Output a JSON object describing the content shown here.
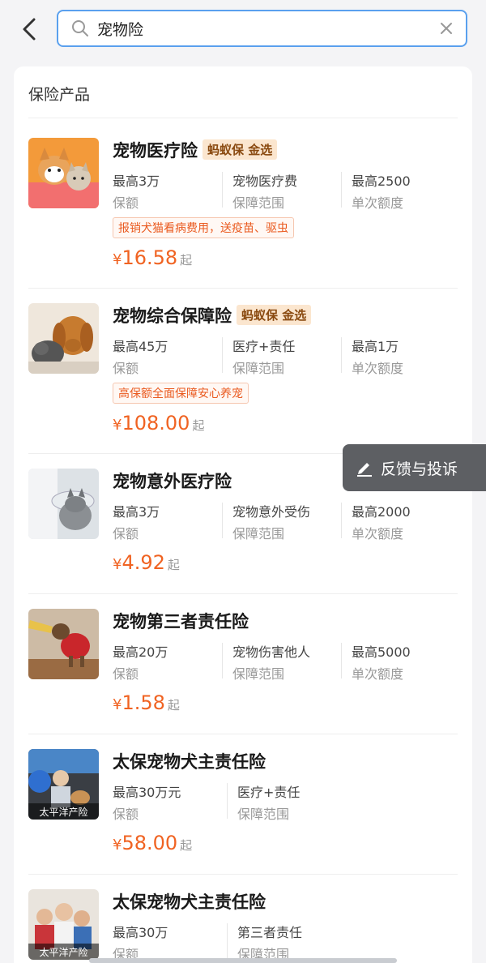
{
  "search": {
    "query": "宠物险"
  },
  "section": {
    "title": "保险产品"
  },
  "products": [
    {
      "name": "宠物医疗险",
      "badge": "蚂蚁保 金选",
      "stats": [
        {
          "value": "最高3万",
          "label": "保额"
        },
        {
          "value": "宠物医疗费",
          "label": "保障范围"
        },
        {
          "value": "最高2500",
          "label": "单次额度"
        }
      ],
      "tag": "报销犬猫看病费用，送疫苗、驱虫",
      "price": {
        "currency": "¥",
        "amount": "16.58",
        "suffix": "起"
      }
    },
    {
      "name": "宠物综合保障险",
      "badge": "蚂蚁保 金选",
      "stats": [
        {
          "value": "最高45万",
          "label": "保额"
        },
        {
          "value": "医疗+责任",
          "label": "保障范围"
        },
        {
          "value": "最高1万",
          "label": "单次额度"
        }
      ],
      "tag": "高保额全面保障安心养宠",
      "price": {
        "currency": "¥",
        "amount": "108.00",
        "suffix": "起"
      }
    },
    {
      "name": "宠物意外医疗险",
      "stats": [
        {
          "value": "最高3万",
          "label": "保额"
        },
        {
          "value": "宠物意外受伤",
          "label": "保障范围"
        },
        {
          "value": "最高2000",
          "label": "单次额度"
        }
      ],
      "price": {
        "currency": "¥",
        "amount": "4.92",
        "suffix": "起"
      }
    },
    {
      "name": "宠物第三者责任险",
      "stats": [
        {
          "value": "最高20万",
          "label": "保额"
        },
        {
          "value": "宠物伤害他人",
          "label": "保障范围"
        },
        {
          "value": "最高5000",
          "label": "单次额度"
        }
      ],
      "price": {
        "currency": "¥",
        "amount": "1.58",
        "suffix": "起"
      }
    },
    {
      "name": "太保宠物犬主责任险",
      "thumb_caption": "太平洋产险",
      "stats": [
        {
          "value": "最高30万元",
          "label": "保额"
        },
        {
          "value": "医疗+责任",
          "label": "保障范围"
        }
      ],
      "price": {
        "currency": "¥",
        "amount": "58.00",
        "suffix": "起"
      }
    },
    {
      "name": "太保宠物犬主责任险",
      "thumb_caption": "太平洋产险",
      "stats": [
        {
          "value": "最高30万",
          "label": "保额"
        },
        {
          "value": "第三者责任",
          "label": "保障范围"
        }
      ]
    }
  ],
  "feedback": {
    "label": "反馈与投诉"
  },
  "colors": {
    "accent": "#f06322",
    "search_border": "#5aa0ee",
    "badge_bg": "#fbe6cf",
    "feedback_bg": "#5d5f63"
  },
  "icons": {
    "back": "chevron-left-icon",
    "search": "search-icon",
    "clear": "close-icon",
    "feedback": "pencil-icon"
  }
}
